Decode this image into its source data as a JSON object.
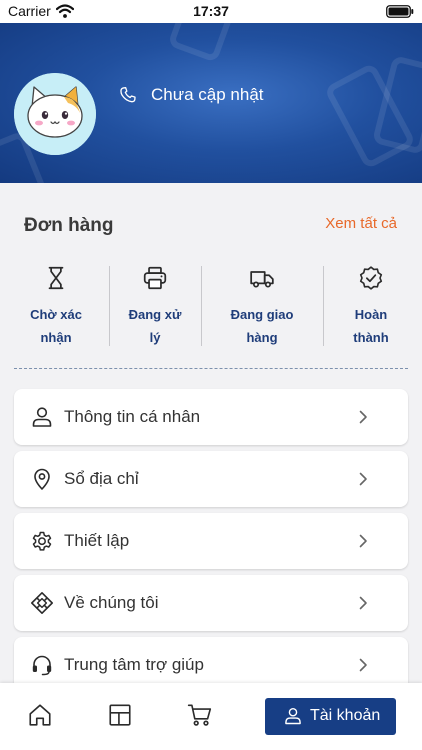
{
  "status_bar": {
    "carrier": "Carrier",
    "time": "17:37"
  },
  "profile": {
    "phone_text": "Chưa cập nhật"
  },
  "orders": {
    "title": "Đơn hàng",
    "view_all": "Xem tất cả",
    "statuses": [
      {
        "line1": "Chờ xác",
        "line2": "nhận",
        "icon": "hourglass-icon"
      },
      {
        "line1": "Đang xử",
        "line2": "lý",
        "icon": "printer-icon"
      },
      {
        "line1": "Đang giao",
        "line2": "hàng",
        "icon": "truck-icon"
      },
      {
        "line1": "Hoàn",
        "line2": "thành",
        "icon": "verified-badge-icon"
      }
    ]
  },
  "menu": [
    {
      "label": "Thông tin cá nhân",
      "icon": "person-icon"
    },
    {
      "label": "Sổ địa chỉ",
      "icon": "location-pin-icon"
    },
    {
      "label": "Thiết lập",
      "icon": "gear-icon"
    },
    {
      "label": "Về chúng tôi",
      "icon": "diamond-grid-icon"
    },
    {
      "label": "Trung tâm trợ giúp",
      "icon": "headset-icon"
    }
  ],
  "tab_bar": {
    "tabs": [
      {
        "icon": "home-icon"
      },
      {
        "icon": "layout-grid-icon"
      },
      {
        "icon": "cart-icon"
      }
    ],
    "active_label": "Tài khoản",
    "active_icon": "person-icon"
  },
  "colors": {
    "header_blue": "#21509f",
    "accent_orange": "#e8692a",
    "order_label_navy": "#1f3d7a",
    "active_tab_bg": "#173e85"
  }
}
